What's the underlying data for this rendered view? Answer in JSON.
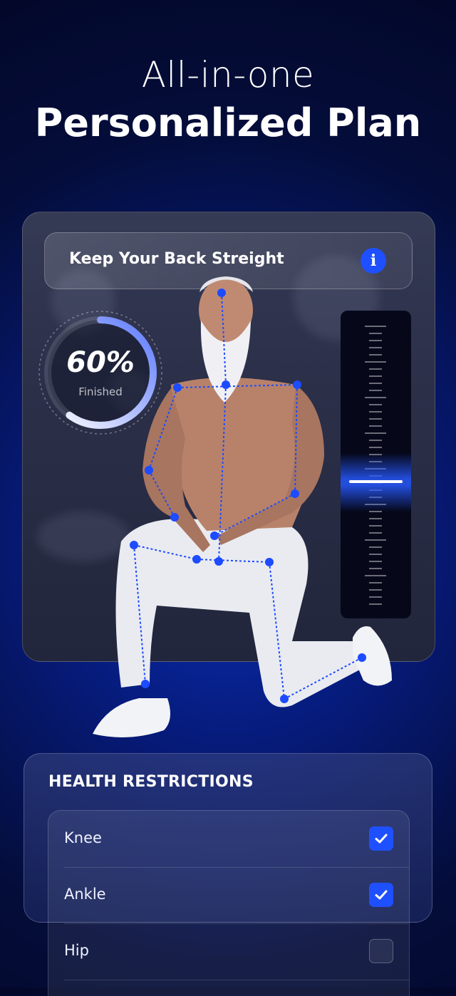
{
  "headline": {
    "line1": "All-in-one",
    "line2": "Personalized Plan"
  },
  "posture_tip": {
    "text": "Keep Your Back Streight",
    "info_icon": "info-icon"
  },
  "progress": {
    "percent_text": "60%",
    "label": "Finished",
    "fraction": 0.6
  },
  "colors": {
    "accent": "#1f50ff",
    "background": "#061a78"
  },
  "health_restrictions": {
    "title": "HEALTH RESTRICTIONS",
    "items": [
      {
        "label": "Knee",
        "checked": true
      },
      {
        "label": "Ankle",
        "checked": true
      },
      {
        "label": "Hip",
        "checked": false
      }
    ]
  }
}
